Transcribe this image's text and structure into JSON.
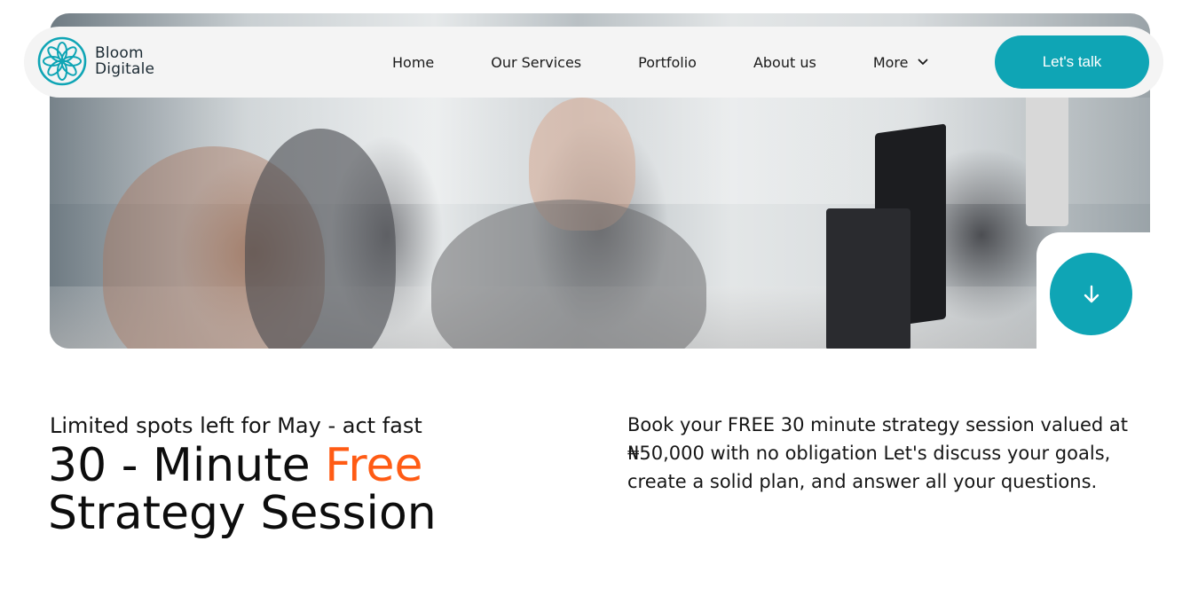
{
  "brand": {
    "name_line1": "Bloom",
    "name_line2": "Digitale",
    "accent_color": "#0fa5b5"
  },
  "nav": {
    "items": [
      {
        "label": "Home"
      },
      {
        "label": "Our Services"
      },
      {
        "label": "Portfolio"
      },
      {
        "label": "About us"
      },
      {
        "label": "More",
        "icon": "chevron-down-icon"
      }
    ],
    "cta_label": "Let's talk"
  },
  "hero": {
    "scroll_icon": "arrow-down-icon"
  },
  "offer": {
    "eyebrow": "Limited spots left for May - act fast",
    "headline_part1": "30 - Minute ",
    "headline_accent": "Free",
    "headline_line2": "Strategy Session",
    "accent_color": "#ff5b14",
    "description": "Book your FREE 30 minute strategy session valued at ₦50,000 with no obligation Let's discuss your goals, create a solid plan, and answer all your questions."
  }
}
